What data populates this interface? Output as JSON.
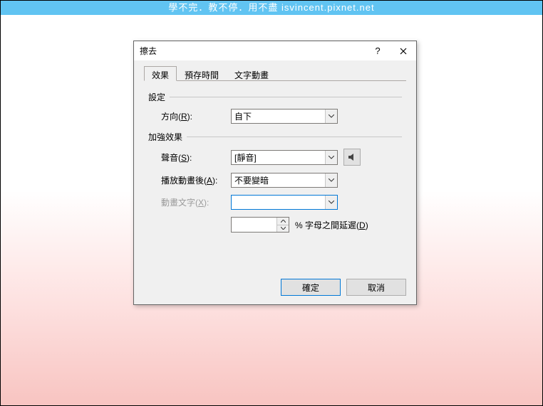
{
  "banner": "學不完．教不停．用不盡 isvincent.pixnet.net",
  "dialog": {
    "title": "擦去",
    "help": "?",
    "tabs": {
      "effect": "效果",
      "timing": "預存時間",
      "text_anim": "文字動畫"
    },
    "groups": {
      "settings": "設定",
      "enhance": "加強效果"
    },
    "labels": {
      "direction_pre": "方向(",
      "direction_hot": "R",
      "direction_post": "):",
      "sound_pre": "聲音(",
      "sound_hot": "S",
      "sound_post": "):",
      "after_pre": "播放動畫後(",
      "after_hot": "A",
      "after_post": "):",
      "animtext_pre": "動畫文字(",
      "animtext_hot": "X",
      "animtext_post": "):",
      "delay_pre": "% 字母之間延遲(",
      "delay_hot": "D",
      "delay_post": ")"
    },
    "values": {
      "direction": "自下",
      "sound": "[靜音]",
      "after": "不要變暗",
      "animtext": "",
      "delay": ""
    },
    "buttons": {
      "ok": "確定",
      "cancel": "取消"
    }
  }
}
